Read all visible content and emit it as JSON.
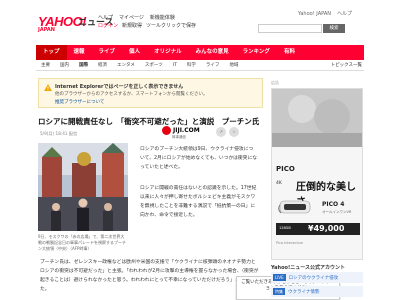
{
  "header": {
    "logo": "YAHOO!",
    "logo_sub": "JAPAN",
    "logo_news": "ニュース",
    "links_top": [
      "ヘルプ",
      "マイページ",
      "新機能体験"
    ],
    "links_bottom": [
      "ログイン",
      "新規取得",
      "ツールクリックで保存"
    ],
    "right_links": [
      "Yahoo! JAPAN",
      "ヘルプ"
    ],
    "search_placeholder": "",
    "search_button": "検索"
  },
  "nav": {
    "items": [
      "トップ",
      "速報",
      "ライブ",
      "個人",
      "オリジナル",
      "みんなの意見",
      "ランキング",
      "有料"
    ],
    "active_index": 0
  },
  "subnav": {
    "items": [
      "主要",
      "国内",
      "国際",
      "経済",
      "エンタメ",
      "スポーツ",
      "IT",
      "科学",
      "ライフ",
      "地域"
    ],
    "active_index": 2,
    "topics": "トピックス一覧"
  },
  "ie_warning": {
    "title": "Internet Explorerではページを正しく表示できません",
    "body": "他のブラウザーからのアクセスするか、スマートフォンから閲覧ください。",
    "link": "推奨ブラウザーについて"
  },
  "article": {
    "title": "ロシアに開戦責任なし　「衝突不可避だった」と演説　プーチン氏",
    "timestamp": "5/9(月) 18:41 配信",
    "source_name": "JIJI.COM",
    "source_sub": "時事通信",
    "caption": "9日、モスクワの「赤の広場」で、第二次世界大戦の戦勝記念日の軍事パレードを視察するプーチン大統領（中央）（AFP時事）",
    "p1": "ロシアのプーチン大統領は9日、ウクライナ侵攻について、2月にロシアが始めなくても、いつかは衝突になっていたと述べた。",
    "p2": "ロシアに開戦の責任はないとの認識を示した。17世紀以来に人々が押し寄せたボルシェビキ主義がモスクワを無視したことを非難する演説で「抵抗策一の日」に向かわ、命令で接近した。",
    "p3": "プーチン氏は、ゼレンスキー政権などは欧州や米国の支援で「ウクライナに核弾頭のネオナチ勢力とロシアの衝突は不可避だった」と主張。「われわれが2月に攻撃の主導権を握らなかった場合、（衝突が起きることは）避けられなかったと思う。われわれにとって不幸になっていただけだろう」と強調した。",
    "feedback": "ご覧いただきありがとうございます。リアクションを教えてください"
  },
  "sidebar": {
    "ad_label": "広告",
    "ad_brand": "PICO",
    "ad_slogan_a": "4K",
    "ad_slogan_b": "圧倒的な美しさ",
    "ad_product": "PICO 4",
    "ad_product_sub": "オールインワンVR",
    "ad_price_label": "128GB",
    "ad_price": "¥49,000",
    "ad_foot": "Pico Interactive",
    "related_heading": "Yahoo!ニュース公式アカウント",
    "related": [
      {
        "tag": "LIVE",
        "text": "ロシアのウクライナ侵攻"
      },
      {
        "tag": "特集",
        "text": "ウクライナ情勢"
      }
    ]
  },
  "colors": {
    "brand": "#ff0033",
    "nav_active": "#cc0000",
    "link": "#0b4f9e",
    "warn_bg": "#fdf7e3"
  }
}
